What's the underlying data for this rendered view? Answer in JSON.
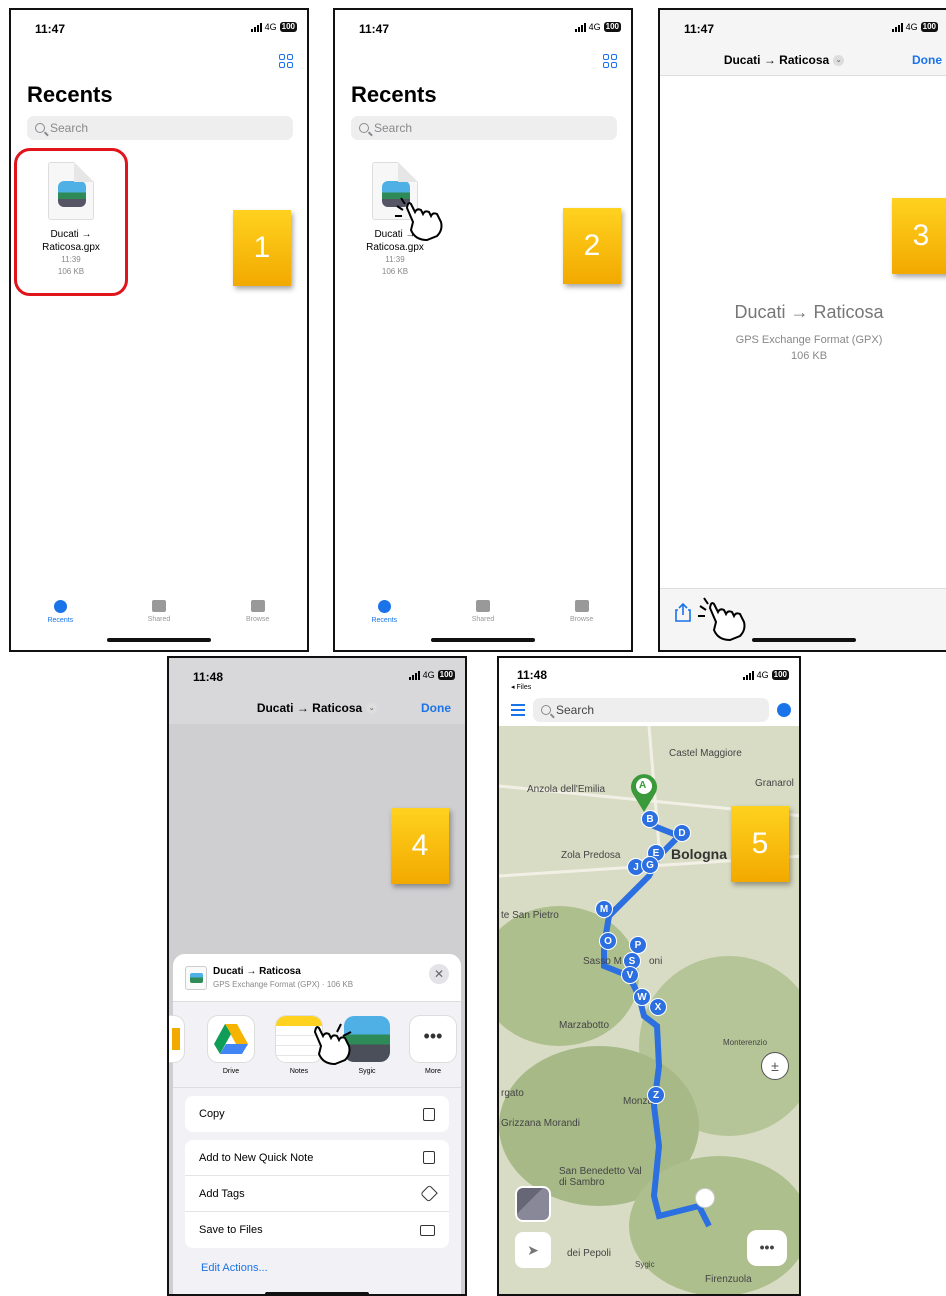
{
  "panels": [
    {
      "time": "11:47",
      "net": "4G",
      "batt": "100",
      "title": "Recents",
      "search": "Search",
      "file": {
        "name1": "Ducati →",
        "name2": "Raticosa.gpx",
        "time": "11:39",
        "size": "106 KB"
      },
      "badge": "1",
      "tabs": [
        "Recents",
        "Shared",
        "Browse"
      ]
    },
    {
      "time": "11:47",
      "net": "4G",
      "batt": "100",
      "title": "Recents",
      "search": "Search",
      "file": {
        "name1": "Ducati →",
        "name2": "Raticosa.gpx",
        "time": "11:39",
        "size": "106 KB"
      },
      "badge": "2",
      "tabs": [
        "Recents",
        "Shared",
        "Browse"
      ]
    },
    {
      "time": "11:47",
      "net": "4G",
      "batt": "100",
      "nav_title": "Ducati → Raticosa",
      "done": "Done",
      "badge": "3",
      "doc_title": "Ducati → Raticosa",
      "doc_type": "GPS Exchange Format (GPX)",
      "doc_size": "106 KB"
    },
    {
      "time": "11:48",
      "net": "4G",
      "batt": "100",
      "nav_title": "Ducati → Raticosa",
      "done": "Done",
      "badge": "4",
      "sheet_title": "Ducati → Raticosa",
      "sheet_sub": "GPS Exchange Format (GPX) · 106 KB",
      "apps": [
        "Drive",
        "Notes",
        "Sygic",
        "More"
      ],
      "copy": "Copy",
      "actions": [
        "Add to New Quick Note",
        "Add Tags",
        "Save to Files"
      ],
      "edit": "Edit Actions..."
    },
    {
      "time": "11:48",
      "back": "◂ Files",
      "net": "4G",
      "batt": "100",
      "search": "Search",
      "badge": "5",
      "labels": [
        "Castel Maggiore",
        "Granarol",
        "Anzola dell'Emilia",
        "Zola Predosa",
        "Bologna",
        "te San Pietro",
        "Sasso M",
        "oni",
        "Marzabotto",
        "Monterenzio",
        "rgato",
        "Monzu",
        "Grizzana Morandi",
        "San Benedetto Val di Sambro",
        "dei Pepoli",
        "Firenzuola",
        "Sygic"
      ],
      "waypoints": [
        "A",
        "B",
        "D",
        "E",
        "J",
        "G",
        "M",
        "O",
        "P",
        "S",
        "V",
        "W",
        "X",
        "Z"
      ]
    }
  ],
  "colors": {
    "accent": "#1a73e8",
    "badge": "#f5b400",
    "route": "#2b6fe0",
    "pin": "#3a9a3a",
    "ring": "#e0151b"
  }
}
